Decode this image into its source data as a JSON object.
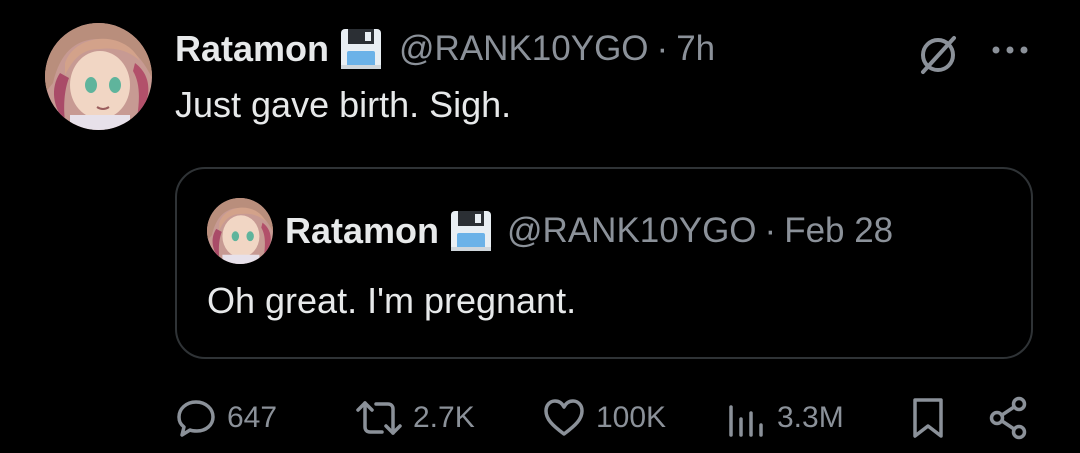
{
  "tweet": {
    "author_name": "Ratamon",
    "author_handle": "@RANK10YGO",
    "separator": "·",
    "time": "7h",
    "text": "Just gave birth. Sigh."
  },
  "quoted_tweet": {
    "author_name": "Ratamon",
    "author_handle": "@RANK10YGO",
    "separator": "·",
    "date": "Feb 28",
    "text": "Oh great. I'm pregnant."
  },
  "actions": {
    "replies": "647",
    "reposts": "2.7K",
    "likes": "100K",
    "views": "3.3M"
  },
  "icons": {
    "reply": "reply-icon",
    "repost": "repost-icon",
    "like": "heart-icon",
    "views": "views-icon",
    "bookmark": "bookmark-icon",
    "share": "share-icon",
    "grok": "grok-icon",
    "more": "more-icon",
    "name_emoji": "floppy-disk-icon"
  },
  "colors": {
    "background": "#000000",
    "primary_text": "#e7e9ea",
    "secondary_text": "#8b9199",
    "quote_border": "#2f3336"
  }
}
